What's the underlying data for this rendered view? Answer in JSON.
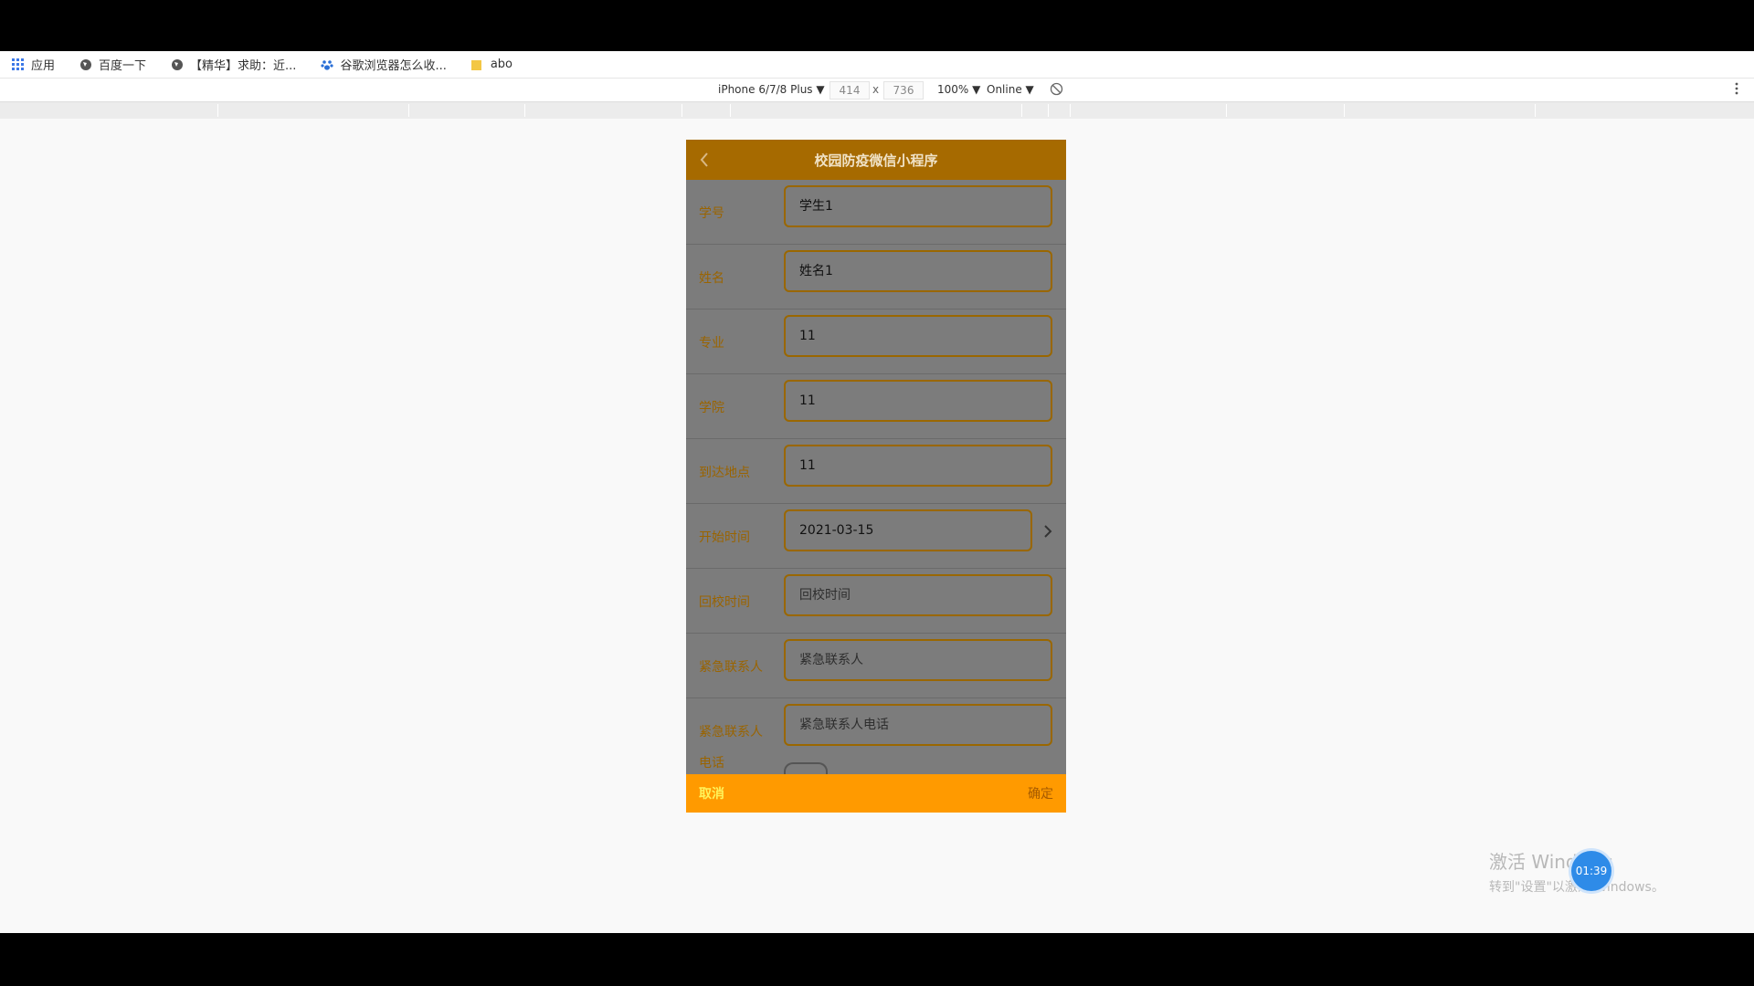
{
  "browser": {
    "bookmarks": [
      "应用",
      "百度一下",
      "【精华】求助：近...",
      "谷歌浏览器怎么收...",
      "abo"
    ]
  },
  "devtools": {
    "device": "iPhone 6/7/8 Plus ▼",
    "width": "414",
    "x_sep": "x",
    "height": "736",
    "zoom": "100% ▼",
    "network": "Online ▼"
  },
  "app": {
    "title": "校园防疫微信小程序",
    "fields": [
      {
        "label": "学号",
        "value": "学生1",
        "placeholder": ""
      },
      {
        "label": "姓名",
        "value": "姓名1",
        "placeholder": ""
      },
      {
        "label": "专业",
        "value": "11",
        "placeholder": ""
      },
      {
        "label": "学院",
        "value": "11",
        "placeholder": ""
      },
      {
        "label": "到达地点",
        "value": "11",
        "placeholder": ""
      },
      {
        "label": "开始时间",
        "value": "2021-03-15",
        "placeholder": ""
      },
      {
        "label": "回校时间",
        "value": "",
        "placeholder": "回校时间"
      },
      {
        "label": "紧急联系人",
        "value": "",
        "placeholder": "紧急联系人"
      },
      {
        "label": "紧急联系人电话",
        "value": "",
        "placeholder": "紧急联系人电话"
      }
    ],
    "cancel_label": "取消",
    "confirm_label": "确定"
  },
  "system": {
    "watermark_line1": "激活 Windows",
    "watermark_line2": "转到\"设置\"以激活 Windows。",
    "timer": "01:39"
  },
  "colors": {
    "nav_bg": "#a66a00",
    "footer_bg": "#ff9a00",
    "field_border": "#9a6700",
    "overlay_gray": "#7c7c7c"
  }
}
